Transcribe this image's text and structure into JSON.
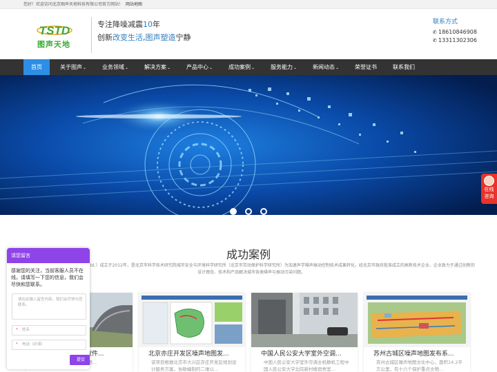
{
  "topbar": {
    "welcome": "您好！欢迎访问北京图声天地科技有限公司官方网站！",
    "sitemap": "网站地图"
  },
  "header": {
    "logo_letters": "TSTD",
    "logo_text": "图声天地",
    "slogan1": {
      "prefix": "专注降噪减震",
      "highlight": "10",
      "suffix": "年"
    },
    "slogan2": {
      "p1": "创新",
      "h1": "改变生活",
      "p2": ",",
      "h2": "图声塑造",
      "p3": "宁静"
    },
    "contact_title": "联系方式",
    "phones": [
      "18610846908",
      "13311302306"
    ]
  },
  "nav": [
    {
      "label": "首页",
      "active": true,
      "caret": ""
    },
    {
      "label": "关于图声",
      "caret": "⌄"
    },
    {
      "label": "业务领域",
      "caret": "⌄"
    },
    {
      "label": "解决方案",
      "caret": "⌄"
    },
    {
      "label": "产品中心",
      "caret": "⌄"
    },
    {
      "label": "成功案例",
      "caret": "⌄"
    },
    {
      "label": "服务能力",
      "caret": "⌄"
    },
    {
      "label": "新闻动态",
      "caret": "⌄"
    },
    {
      "label": "荣誉证书",
      "caret": ""
    },
    {
      "label": "联系我们",
      "caret": ""
    }
  ],
  "slider": {
    "count": 3,
    "active": 0
  },
  "side_float": {
    "line1": "在线",
    "line2": "咨询"
  },
  "section": {
    "title": "成功案例",
    "desc": "Beijing NVM Technology Co., Ltd.）成立于2012年，是北京市科学技术研究院城市安全与环境科学研究所（北京市劳动保护科学研究所）为加速声学噪声振动控制技术成果转化，经北京市政府批准成立的高新技术企业，企业致力于通过创新的设计理念、技术和产品解决城市各类噪声与振动污染问题。"
  },
  "cards": [
    {
      "title": "某单位声屏障降噪软件...",
      "desc": "为某单位专门研究开发应用..."
    },
    {
      "title": "北京亦庄开发区噪声地图发...",
      "desc": "该项目根据北京市大兴区亦庄开发区规划设计服务方案，协助编制的二维以..."
    },
    {
      "title": "中国人民公安大学室外空调...",
      "desc": "中国人民公安大学室外空调主机静机工程中国人民公安大学北院新村楼宿舍室..."
    },
    {
      "title": "苏州古城区噪声地图发布系...",
      "desc": "苏州古城区噪声地图文化中心，面积14.2平方公里，有十六个保护重点文物..."
    }
  ],
  "chat": {
    "header": "请您留言",
    "greeting": "感谢您的关注，当前客服人员不在线，请填写一下您的信息，我们会尽快和您联系。",
    "textarea_placeholder": "请在此输入留言内容，我们会尽快与您联系。",
    "name_placeholder": "姓名",
    "phone_placeholder": "电话（必填）",
    "submit": "提交",
    "req": "*"
  },
  "colors": {
    "accent": "#2d8ee6",
    "nav_bg": "#333333",
    "brand_green": "#3aa935",
    "chat_purple": "#8e44e8",
    "float_red": "#e7332a"
  }
}
